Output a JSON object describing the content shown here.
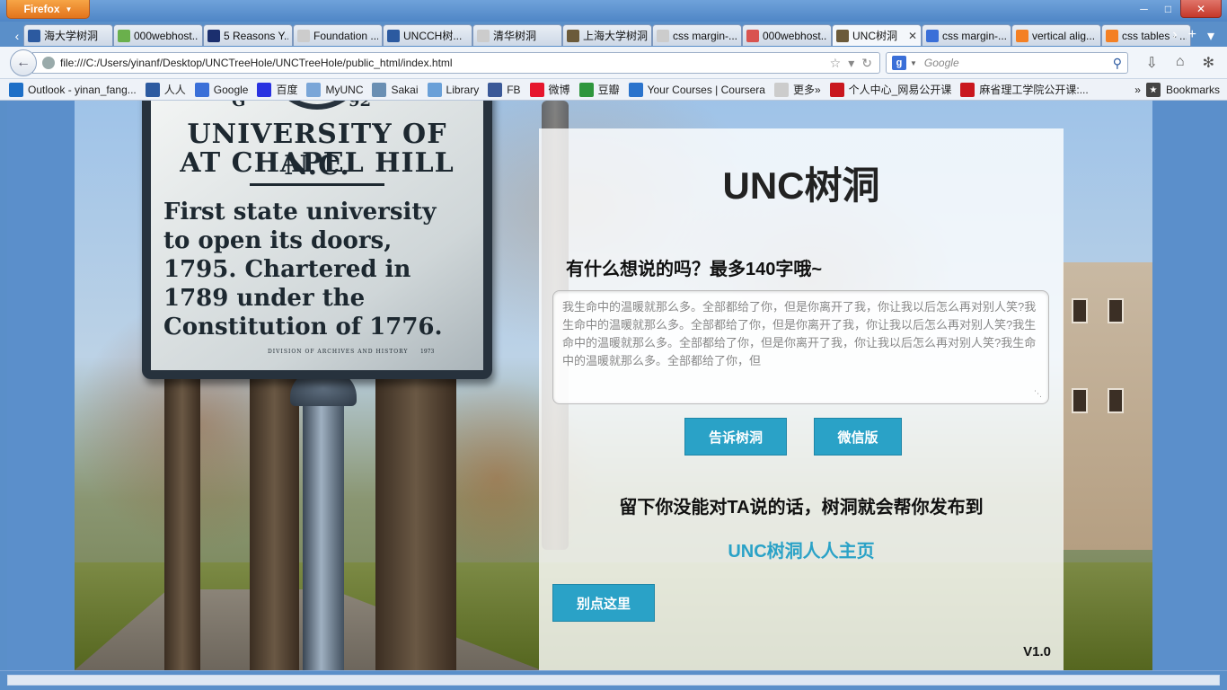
{
  "window": {
    "firefox_button": "Firefox",
    "controls": [
      "minimize",
      "maximize",
      "close"
    ]
  },
  "tabs": [
    {
      "label": "海大学树洞",
      "favicon": "renren-icon",
      "color": "#2c5aa0",
      "active": false
    },
    {
      "label": "000webhost...",
      "favicon": "webhost-icon",
      "color": "#6ab04c",
      "active": false
    },
    {
      "label": "5 Reasons Y...",
      "favicon": "f-icon",
      "color": "#1b2f6e",
      "active": false
    },
    {
      "label": "Foundation ...",
      "favicon": "blank-page-icon",
      "color": "#cccccc",
      "active": false
    },
    {
      "label": "UNCCH树...",
      "favicon": "renren-icon",
      "color": "#2c5aa0",
      "active": false
    },
    {
      "label": "清华树洞",
      "favicon": "blank-page-icon",
      "color": "#cccccc",
      "active": false
    },
    {
      "label": "上海大学树洞",
      "favicon": "photo-icon",
      "color": "#6b5a3a",
      "active": false
    },
    {
      "label": "css margin-...",
      "favicon": "blank-page-icon",
      "color": "#cccccc",
      "active": false
    },
    {
      "label": "000webhost...",
      "favicon": "webhost-icon",
      "color": "#d9534f",
      "active": false
    },
    {
      "label": "UNC树洞",
      "favicon": "photo-icon",
      "color": "#6b5a3a",
      "active": true
    },
    {
      "label": "css margin-...",
      "favicon": "google-icon",
      "color": "#3a6fd8",
      "active": false
    },
    {
      "label": "vertical alig...",
      "favicon": "stackoverflow-icon",
      "color": "#f48024",
      "active": false
    },
    {
      "label": "css tables - ...",
      "favicon": "stackoverflow-icon",
      "color": "#f48024",
      "active": false
    }
  ],
  "nav": {
    "url": "file:///C:/Users/yinanf/Desktop/UNCTreeHole/UNCTreeHole/public_html/index.html",
    "search_placeholder": "Google"
  },
  "bookmarks": [
    {
      "label": "Outlook - yinan_fang...",
      "icon": "outlook-icon",
      "color": "#1e6fc7"
    },
    {
      "label": "人人",
      "icon": "renren-icon",
      "color": "#2c5aa0"
    },
    {
      "label": "Google",
      "icon": "google-icon",
      "color": "#3a6fd8"
    },
    {
      "label": "百度",
      "icon": "baidu-icon",
      "color": "#2932e1"
    },
    {
      "label": "MyUNC",
      "icon": "myunc-icon",
      "color": "#7aa6d8"
    },
    {
      "label": "Sakai",
      "icon": "sakai-icon",
      "color": "#6a8fb3"
    },
    {
      "label": "Library",
      "icon": "library-icon",
      "color": "#6aa0d8"
    },
    {
      "label": "FB",
      "icon": "facebook-icon",
      "color": "#3b5998"
    },
    {
      "label": "微博",
      "icon": "weibo-icon",
      "color": "#e6162d"
    },
    {
      "label": "豆瓣",
      "icon": "douban-icon",
      "color": "#2e963d"
    },
    {
      "label": "Your Courses | Coursera",
      "icon": "coursera-icon",
      "color": "#2a73cc"
    },
    {
      "label": "更多»",
      "icon": "blank-page-icon",
      "color": "#cccccc"
    },
    {
      "label": "个人中心_网易公开课",
      "icon": "netease-icon",
      "color": "#c9171e"
    },
    {
      "label": "麻省理工学院公开课:...",
      "icon": "netease-icon",
      "color": "#c9171e"
    }
  ],
  "bookmarks_menu": "Bookmarks",
  "marker": {
    "letter": "G",
    "number": "92",
    "line1": "UNIVERSITY OF N.C.",
    "line2": "AT CHAPEL HILL",
    "body": "First state university to open its doors, 1795. Chartered in 1789 under the Constitution of 1776.",
    "foot": "DIVISION OF ARCHIVES AND HISTORY",
    "year": "1973"
  },
  "panel": {
    "title": "UNC树洞",
    "prompt": "有什么想说的吗？最多140字哦~",
    "message_placeholder": "我生命中的温暖就那么多。全部都给了你，但是你离开了我，你让我以后怎么再对别人笑?我生命中的温暖就那么多。全部都给了你，但是你离开了我，你让我以后怎么再对别人笑?我生命中的温暖就那么多。全部都给了你，但是你离开了我，你让我以后怎么再对别人笑?我生命中的温暖就那么多。全部都给了你，但",
    "tell_button": "告诉树洞",
    "wechat_button": "微信版",
    "info": "留下你没能对TA说的话，树洞就会帮你发布到",
    "renren_link": "UNC树洞人人主页",
    "dont_button": "别点这里",
    "version": "V1.0"
  },
  "colors": {
    "accent": "#2aa2c7",
    "chrome": "#5a8fc9"
  }
}
